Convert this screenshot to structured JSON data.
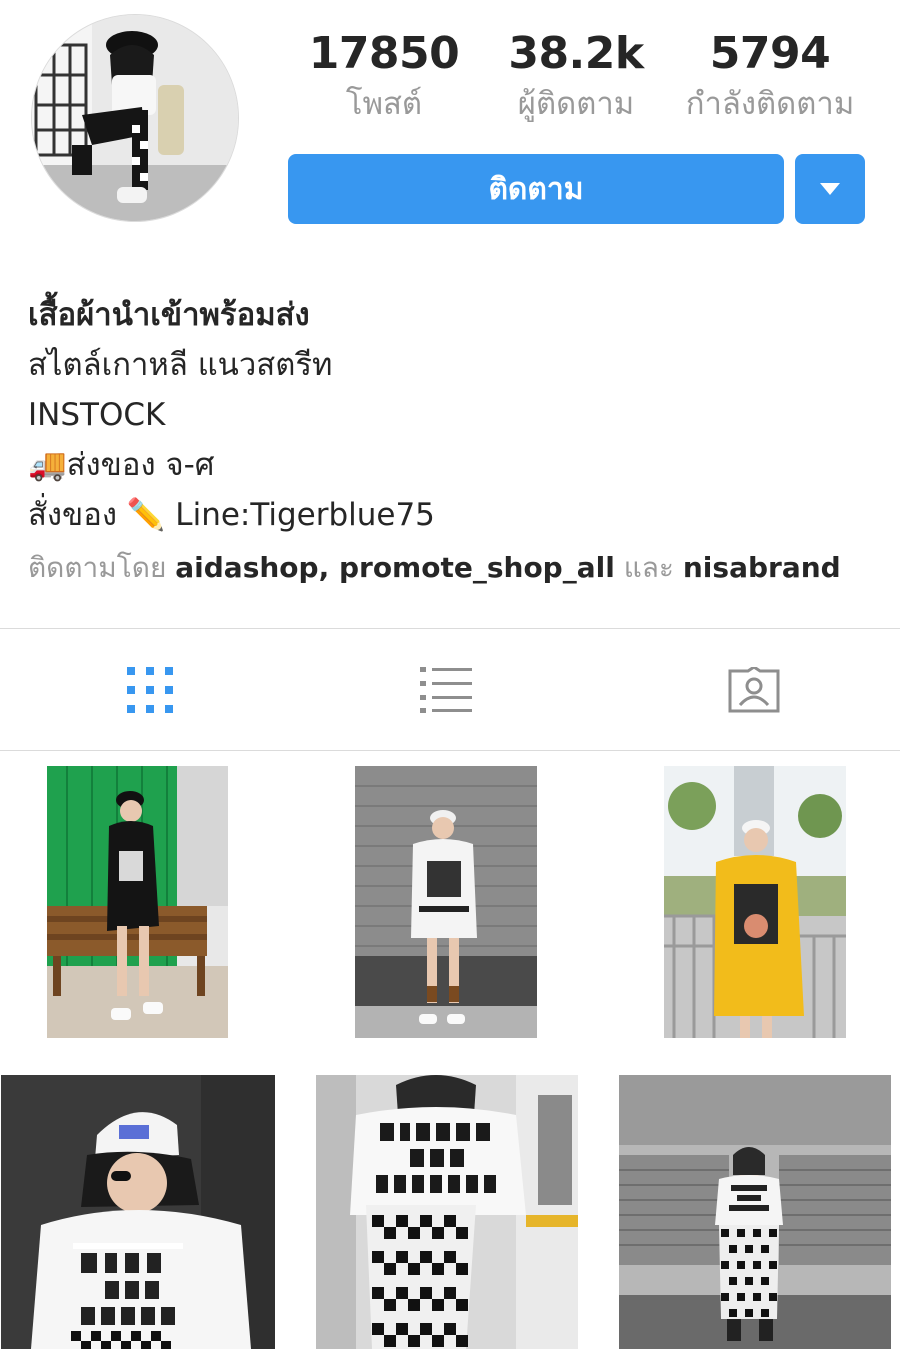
{
  "profile": {
    "stats": [
      {
        "value": "17850",
        "label": "โพสต์"
      },
      {
        "value": "38.2k",
        "label": "ผู้ติดตาม"
      },
      {
        "value": "5794",
        "label": "กำลังติดตาม"
      }
    ],
    "follow_label": "ติดตาม",
    "bio": {
      "name": "เสื้อผ้านำเข้าพร้อมส่ง",
      "line1": "สไตล์เกาหลี แนวสตรีท",
      "line2": "INSTOCK",
      "line3": "🚚ส่งของ จ-ศ",
      "line4": "สั่งของ ✏️ Line:Tigerblue75"
    },
    "followed_by": {
      "prefix": "ติดตามโดย",
      "users": [
        "aidashop",
        "promote_shop_all",
        "nisabrand"
      ],
      "separator": ", ",
      "conjunction": "และ"
    }
  },
  "tabs": [
    {
      "icon": "grid-icon",
      "active": true
    },
    {
      "icon": "list-icon",
      "active": false
    },
    {
      "icon": "tagged-icon",
      "active": false
    }
  ],
  "colors": {
    "accent": "#3897f0",
    "muted": "#999999",
    "text": "#262626"
  },
  "posts": [
    {
      "icon": "photo-post-1"
    },
    {
      "icon": "photo-post-2"
    },
    {
      "icon": "photo-post-3"
    },
    {
      "icon": "photo-post-4"
    },
    {
      "icon": "photo-post-5"
    },
    {
      "icon": "photo-post-6"
    }
  ]
}
